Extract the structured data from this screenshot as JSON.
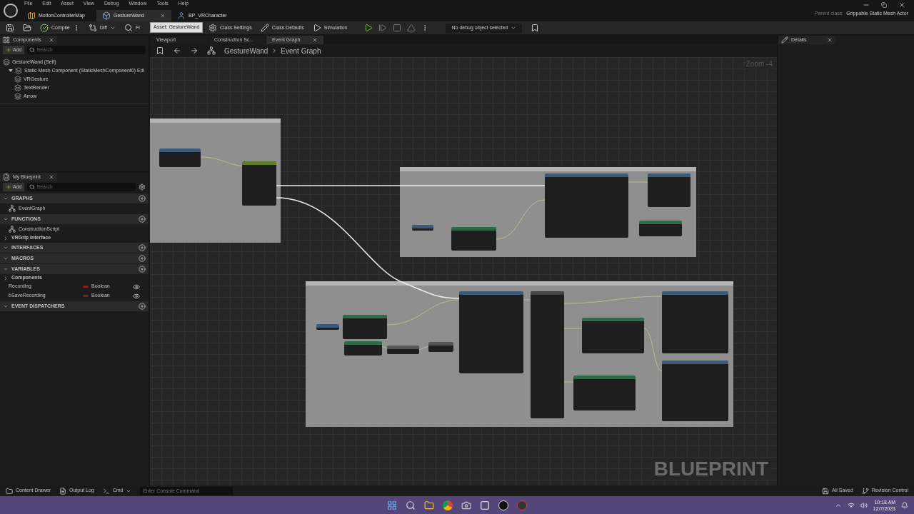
{
  "menu": [
    "File",
    "Edit",
    "Asset",
    "View",
    "Debug",
    "Window",
    "Tools",
    "Help"
  ],
  "doc_tabs": [
    {
      "label": "MotionControllerMap",
      "kind": "map",
      "selected": false
    },
    {
      "label": "GestureWand",
      "kind": "blueprint",
      "selected": true
    },
    {
      "label": "BP_VRCharacter",
      "kind": "character",
      "selected": false
    }
  ],
  "tooltip": "Asset: GestureWand",
  "parent_class": {
    "label": "Parent class:",
    "value": "Grippable Static Mesh Actor"
  },
  "toolbar": {
    "compile": "Compile",
    "diff": "Diff",
    "find": "Fi",
    "class_settings": "Class Settings",
    "class_defaults": "Class Defaults",
    "simulation": "Simulation",
    "debug_select": "No debug object selected"
  },
  "components": {
    "title": "Components",
    "add": "Add",
    "search_placeholder": "Search",
    "tree": [
      {
        "label": "GestureWand (Self)",
        "children": [
          {
            "label": "Static Mesh Component (StaticMeshComponent0) Edi",
            "expanded": true,
            "children": [
              {
                "label": "VRGesture"
              },
              {
                "label": "TextRender"
              },
              {
                "label": "Arrow"
              }
            ]
          }
        ]
      }
    ]
  },
  "my_blueprint": {
    "title": "My Blueprint",
    "add": "Add",
    "search_placeholder": "Search",
    "sections": [
      {
        "title": "GRAPHS",
        "items": [
          {
            "label": "EventGraph"
          }
        ]
      },
      {
        "title": "FUNCTIONS",
        "items": [
          {
            "label": "ConstructionScript"
          }
        ]
      },
      {
        "title": "VRGrip Interface",
        "kind": "category"
      },
      {
        "title": "INTERFACES"
      },
      {
        "title": "MACROS"
      },
      {
        "title": "VARIABLES",
        "items": [
          {
            "label": "Components",
            "kind": "category"
          },
          {
            "label": "Recording",
            "type": "Boolean",
            "kind": "variable"
          },
          {
            "label": "bSaveRecording",
            "type": "Boolean",
            "kind": "variable"
          }
        ]
      },
      {
        "title": "EVENT DISPATCHERS"
      }
    ]
  },
  "graph_tabs": [
    {
      "label": "Viewport",
      "selected": false
    },
    {
      "label": "Construction Sc...",
      "selected": false
    },
    {
      "label": "Event Graph",
      "selected": true
    }
  ],
  "breadcrumb": [
    "GestureWand",
    "Event Graph"
  ],
  "zoom": "Zoom -4",
  "watermark": "BLUEPRINT",
  "details": {
    "title": "Details"
  },
  "status_bar": {
    "content_drawer": "Content Drawer",
    "output_log": "Output Log",
    "cmd": "Cmd",
    "console_placeholder": "Enter Console Command",
    "saved": "All Saved",
    "revision": "Revision Control"
  },
  "taskbar": {
    "time": "10:18 AM",
    "date": "12/7/2023"
  }
}
